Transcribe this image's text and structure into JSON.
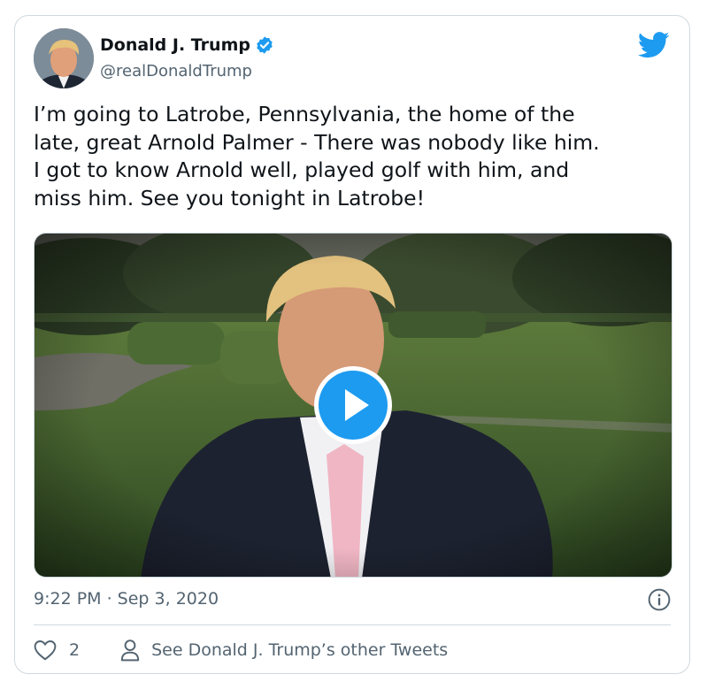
{
  "tweet": {
    "author_name": "Donald J. Trump",
    "author_handle": "@realDonaldTrump",
    "text": "I’m going to Latrobe, Pennsylvania, the home of the\nlate, great Arnold Palmer - There was nobody like him.\nI got to know Arnold well, played golf with him, and\nmiss him. See you tonight in Latrobe!",
    "timestamp": "9:22 PM · Sep 3, 2020",
    "like_count": "2",
    "other_tweets_label": "See Donald J. Trump’s other Tweets"
  },
  "icons": {
    "verified": "verified-badge-icon",
    "platform": "twitter-bird-icon",
    "play": "play-icon",
    "info": "info-icon",
    "like": "heart-icon",
    "profile": "person-icon"
  },
  "colors": {
    "brand_blue": "#1d9bf0",
    "text_primary": "#0f1419",
    "text_secondary": "#536471",
    "border": "#cfd9de"
  }
}
